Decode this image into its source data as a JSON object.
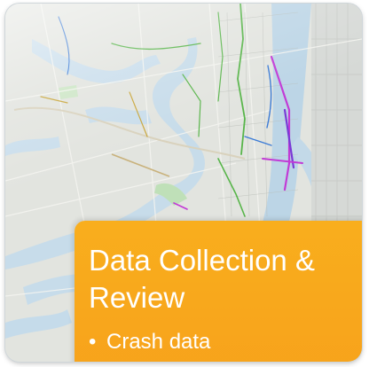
{
  "card": {
    "title": "Data Collection & Review",
    "bullets": [
      "Crash data"
    ]
  },
  "colors": {
    "card_orange": "#f8a71c",
    "water": "#c7dfec",
    "land": "#e3e5e1",
    "route_magenta": "#c23bd6",
    "route_green": "#58b54a",
    "route_blue": "#3b7bd6"
  }
}
